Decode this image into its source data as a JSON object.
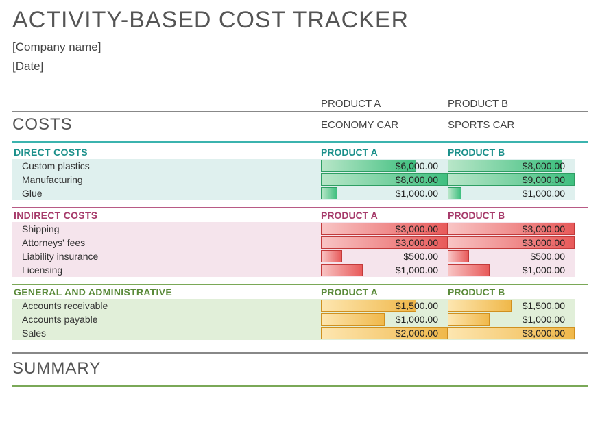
{
  "header": {
    "title": "ACTIVITY-BASED COST TRACKER",
    "company": "[Company name]",
    "date": "[Date]"
  },
  "columns": {
    "a_label": "PRODUCT A",
    "b_label": "PRODUCT B",
    "a_name": "ECONOMY CAR",
    "b_name": "SPORTS CAR"
  },
  "sections": {
    "costs_title": "COSTS",
    "summary_title": "SUMMARY"
  },
  "direct": {
    "heading": "DIRECT COSTS",
    "col_a": "PRODUCT A",
    "col_b": "PRODUCT B",
    "rows": [
      {
        "label": "Custom plastics",
        "a": "$6,000.00",
        "a_pct": 75,
        "b": "$8,000.00",
        "b_pct": 90
      },
      {
        "label": "Manufacturing",
        "a": "$8,000.00",
        "a_pct": 100,
        "b": "$9,000.00",
        "b_pct": 100
      },
      {
        "label": "Glue",
        "a": "$1,000.00",
        "a_pct": 13,
        "b": "$1,000.00",
        "b_pct": 11
      }
    ]
  },
  "indirect": {
    "heading": "INDIRECT COSTS",
    "col_a": "PRODUCT A",
    "col_b": "PRODUCT B",
    "rows": [
      {
        "label": "Shipping",
        "a": "$3,000.00",
        "a_pct": 100,
        "b": "$3,000.00",
        "b_pct": 100
      },
      {
        "label": "Attorneys' fees",
        "a": "$3,000.00",
        "a_pct": 100,
        "b": "$3,000.00",
        "b_pct": 100
      },
      {
        "label": "Liability insurance",
        "a": "$500.00",
        "a_pct": 17,
        "b": "$500.00",
        "b_pct": 17
      },
      {
        "label": "Licensing",
        "a": "$1,000.00",
        "a_pct": 33,
        "b": "$1,000.00",
        "b_pct": 33
      }
    ]
  },
  "general": {
    "heading": "GENERAL AND ADMINISTRATIVE",
    "col_a": "PRODUCT A",
    "col_b": "PRODUCT B",
    "rows": [
      {
        "label": "Accounts receivable",
        "a": "$1,500.00",
        "a_pct": 75,
        "b": "$1,500.00",
        "b_pct": 50
      },
      {
        "label": "Accounts payable",
        "a": "$1,000.00",
        "a_pct": 50,
        "b": "$1,000.00",
        "b_pct": 33
      },
      {
        "label": "Sales",
        "a": "$2,000.00",
        "a_pct": 100,
        "b": "$3,000.00",
        "b_pct": 100
      }
    ]
  }
}
